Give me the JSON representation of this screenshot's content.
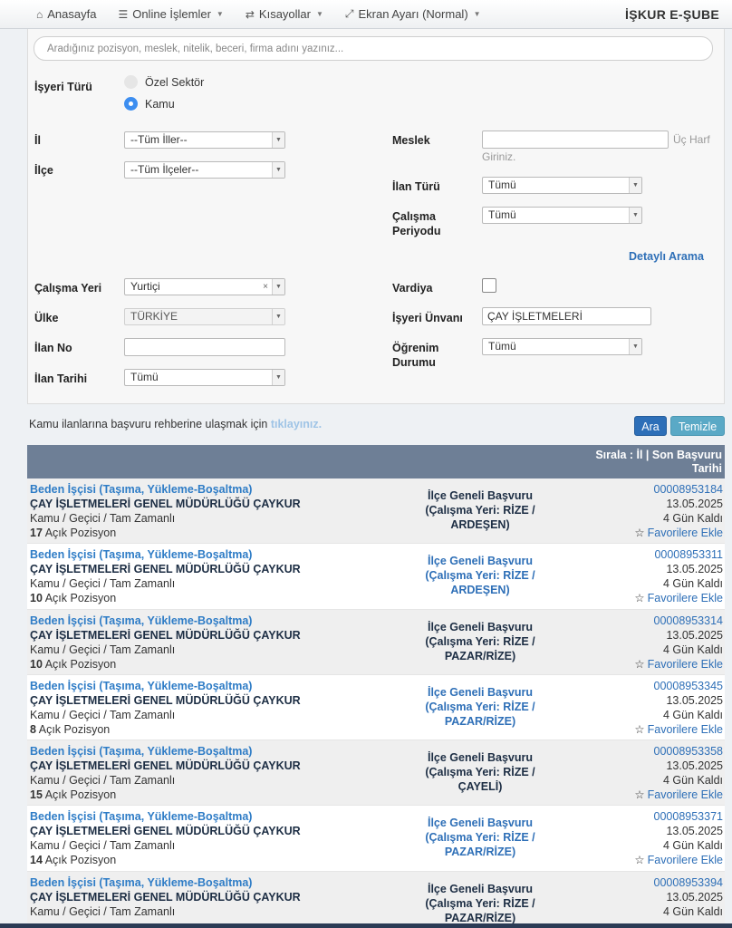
{
  "nav": {
    "home": "Anasayfa",
    "online": "Online İşlemler",
    "shortcuts": "Kısayollar",
    "screen": "Ekran Ayarı (Normal)",
    "brand": "İŞKUR E-ŞUBE"
  },
  "search": {
    "placeholder": "Aradığınız pozisyon, meslek, nitelik, beceri, firma adını yazınız..."
  },
  "filters": {
    "employer_type_label": "İşyeri Türü",
    "opt_private": "Özel Sektör",
    "opt_public": "Kamu",
    "province_label": "İl",
    "province_value": "--Tüm İller--",
    "district_label": "İlçe",
    "district_value": "--Tüm İlçeler--",
    "occupation_label": "Meslek",
    "occupation_hint_a": "Üç Harf",
    "occupation_hint_b": "Giriniz.",
    "ad_type_label": "İlan Türü",
    "ad_type_value": "Tümü",
    "period_label_a": "Çalışma",
    "period_label_b": "Periyodu",
    "period_value": "Tümü",
    "advanced_link": "Detaylı Arama",
    "workplace_label": "Çalışma Yeri",
    "workplace_value": "Yurtiçi",
    "shift_label": "Vardiya",
    "country_label": "Ülke",
    "country_value": "TÜRKİYE",
    "employer_title_label": "İşyeri Ünvanı",
    "employer_title_value": "ÇAY İŞLETMELERİ",
    "ad_no_label": "İlan No",
    "edu_label_a": "Öğrenim",
    "edu_label_b": "Durumu",
    "edu_value": "Tümü",
    "ad_date_label": "İlan Tarihi",
    "ad_date_value": "Tümü"
  },
  "guide": {
    "text": "Kamu ilanlarına başvuru rehberine ulaşmak için",
    "link": "tıklayınız."
  },
  "buttons": {
    "search": "Ara",
    "clear": "Temizle"
  },
  "results": {
    "sort_line1": "Sırala : İl | Son Başvuru",
    "sort_line2": "Tarihi",
    "rows": [
      {
        "job": "Beden İşçisi (Taşıma, Yükleme-Boşaltma)",
        "firm": "ÇAY İŞLETMELERİ GENEL MÜDÜRLÜĞÜ ÇAYKUR",
        "meta": "Kamu / Geçici / Tam Zamanlı",
        "count": "17",
        "count_label": "Açık Pozisyon",
        "apply_1": "İlçe Geneli Başvuru",
        "apply_2": "(Çalışma Yeri: RİZE /",
        "apply_3": "ARDEŞEN)",
        "no": "00008953184",
        "date": "13.05.2025",
        "left": "4 Gün Kaldı",
        "fav": "Favorilere Ekle"
      },
      {
        "job": "Beden İşçisi (Taşıma, Yükleme-Boşaltma)",
        "firm": "ÇAY İŞLETMELERİ GENEL MÜDÜRLÜĞÜ ÇAYKUR",
        "meta": "Kamu / Geçici / Tam Zamanlı",
        "count": "10",
        "count_label": "Açık Pozisyon",
        "apply_1": "İlçe Geneli Başvuru",
        "apply_2": "(Çalışma Yeri: RİZE /",
        "apply_3": "ARDEŞEN)",
        "no": "00008953311",
        "date": "13.05.2025",
        "left": "4 Gün Kaldı",
        "fav": "Favorilere Ekle"
      },
      {
        "job": "Beden İşçisi (Taşıma, Yükleme-Boşaltma)",
        "firm": "ÇAY İŞLETMELERİ GENEL MÜDÜRLÜĞÜ ÇAYKUR",
        "meta": "Kamu / Geçici / Tam Zamanlı",
        "count": "10",
        "count_label": "Açık Pozisyon",
        "apply_1": "İlçe Geneli Başvuru",
        "apply_2": "(Çalışma Yeri: RİZE /",
        "apply_3": "PAZAR/RİZE)",
        "no": "00008953314",
        "date": "13.05.2025",
        "left": "4 Gün Kaldı",
        "fav": "Favorilere Ekle"
      },
      {
        "job": "Beden İşçisi (Taşıma, Yükleme-Boşaltma)",
        "firm": "ÇAY İŞLETMELERİ GENEL MÜDÜRLÜĞÜ ÇAYKUR",
        "meta": "Kamu / Geçici / Tam Zamanlı",
        "count": "8",
        "count_label": "Açık Pozisyon",
        "apply_1": "İlçe Geneli Başvuru",
        "apply_2": "(Çalışma Yeri: RİZE /",
        "apply_3": "PAZAR/RİZE)",
        "no": "00008953345",
        "date": "13.05.2025",
        "left": "4 Gün Kaldı",
        "fav": "Favorilere Ekle"
      },
      {
        "job": "Beden İşçisi (Taşıma, Yükleme-Boşaltma)",
        "firm": "ÇAY İŞLETMELERİ GENEL MÜDÜRLÜĞÜ ÇAYKUR",
        "meta": "Kamu / Geçici / Tam Zamanlı",
        "count": "15",
        "count_label": "Açık Pozisyon",
        "apply_1": "İlçe Geneli Başvuru",
        "apply_2": "(Çalışma Yeri: RİZE /",
        "apply_3": "ÇAYELİ)",
        "no": "00008953358",
        "date": "13.05.2025",
        "left": "4 Gün Kaldı",
        "fav": "Favorilere Ekle"
      },
      {
        "job": "Beden İşçisi (Taşıma, Yükleme-Boşaltma)",
        "firm": "ÇAY İŞLETMELERİ GENEL MÜDÜRLÜĞÜ ÇAYKUR",
        "meta": "Kamu / Geçici / Tam Zamanlı",
        "count": "14",
        "count_label": "Açık Pozisyon",
        "apply_1": "İlçe Geneli Başvuru",
        "apply_2": "(Çalışma Yeri: RİZE /",
        "apply_3": "PAZAR/RİZE)",
        "no": "00008953371",
        "date": "13.05.2025",
        "left": "4 Gün Kaldı",
        "fav": "Favorilere Ekle"
      },
      {
        "job": "Beden İşçisi (Taşıma, Yükleme-Boşaltma)",
        "firm": "ÇAY İŞLETMELERİ GENEL MÜDÜRLÜĞÜ ÇAYKUR",
        "meta": "Kamu / Geçici / Tam Zamanlı",
        "count": "",
        "count_label": "",
        "apply_1": "İlçe Geneli Başvuru",
        "apply_2": "(Çalışma Yeri: RİZE /",
        "apply_3": "PAZAR/RİZE)",
        "no": "00008953394",
        "date": "13.05.2025",
        "left": "4 Gün Kaldı",
        "fav": ""
      }
    ]
  }
}
